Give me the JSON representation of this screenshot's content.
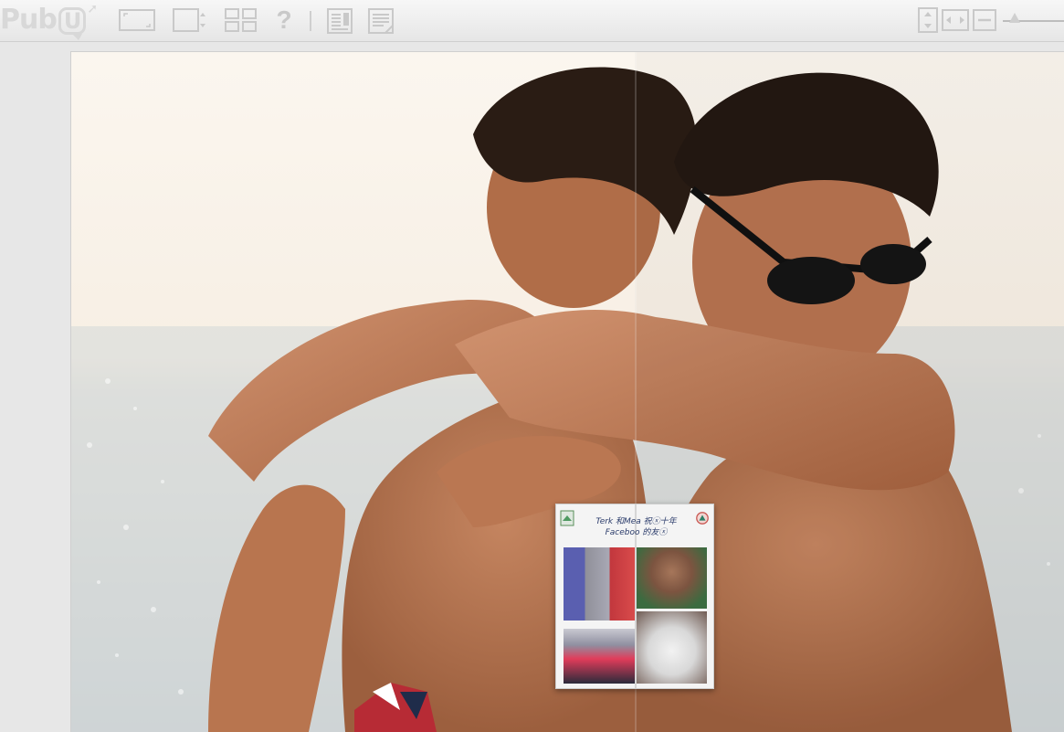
{
  "toolbar": {
    "logo_text": "Pub",
    "logo_u": "U",
    "help_label": "?",
    "icons": [
      "fit-page-icon",
      "fit-width-icon",
      "thumbnails-icon",
      "help-icon",
      "single-page-icon",
      "double-page-icon",
      "fit-height-icon",
      "actual-width-icon",
      "zoom-out-icon"
    ],
    "zoom_level": 0.2
  },
  "thumbnail": {
    "caption_line1": "Terk 和Mea 祝ⓧ十年",
    "caption_line2": "Faceboo 的友ⓧ"
  },
  "colors": {
    "toolbar_icon": "#c9c9c9",
    "background": "#e7e7e7",
    "caption": "#2b3c6b"
  }
}
